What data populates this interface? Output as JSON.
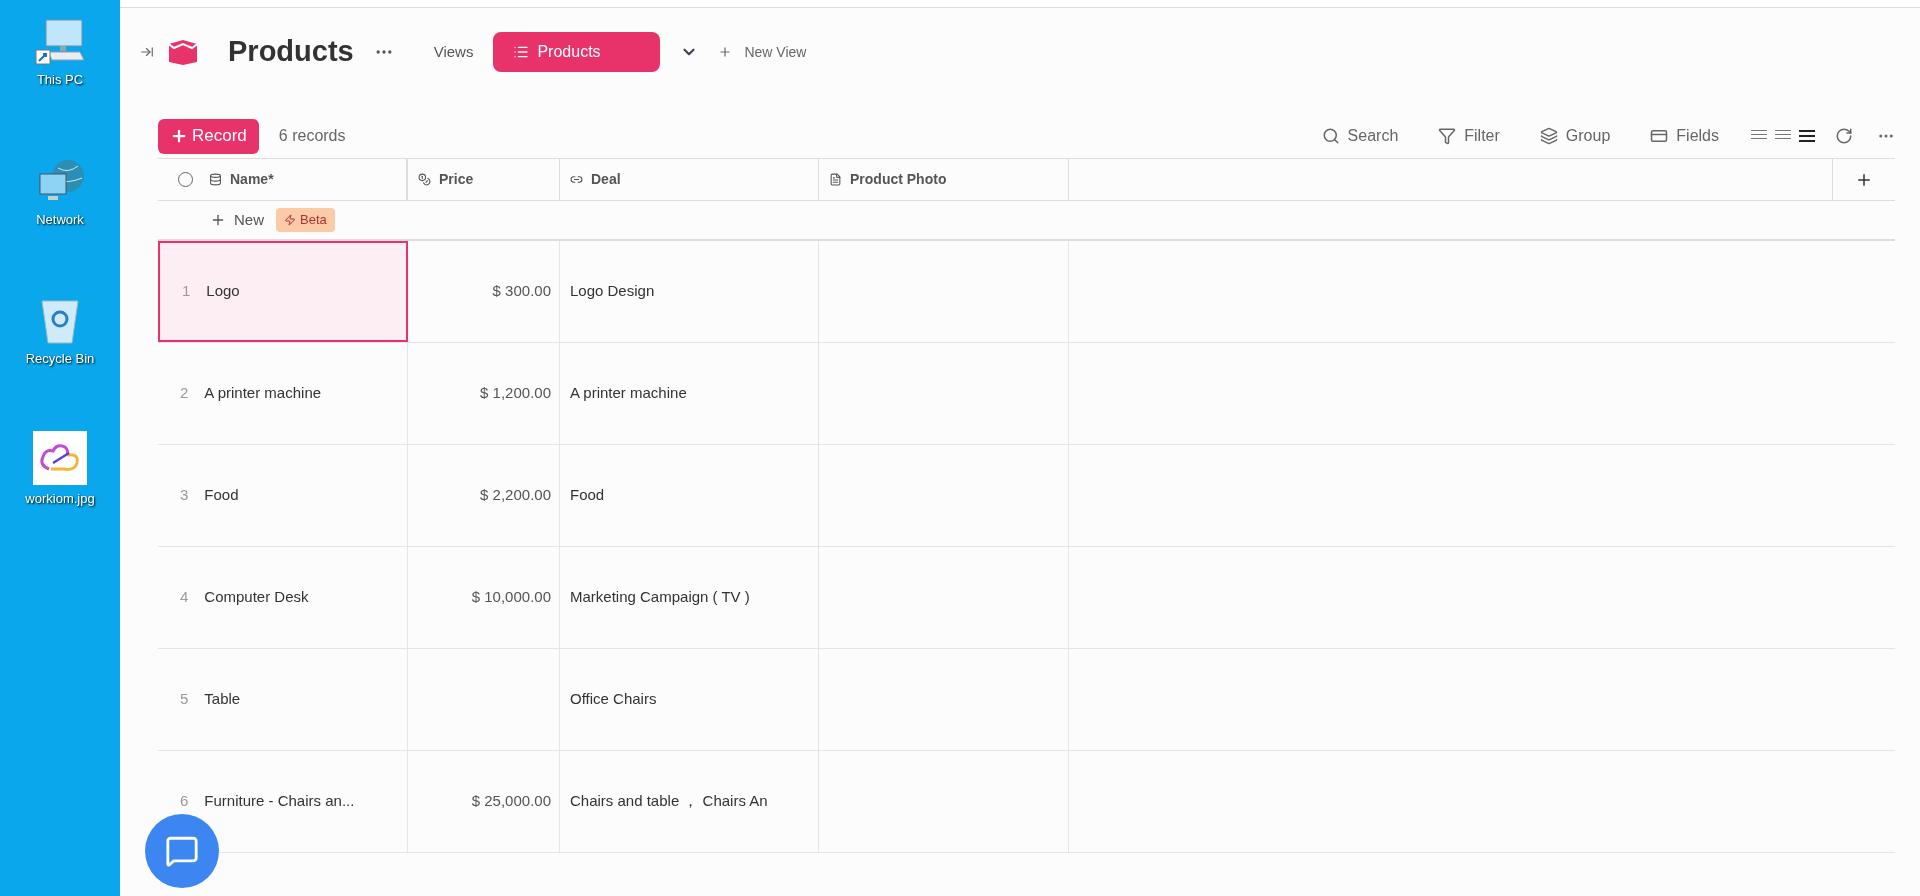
{
  "desktop_icons": [
    {
      "label": "This PC",
      "kind": "pc"
    },
    {
      "label": "Network",
      "kind": "network"
    },
    {
      "label": "Recycle Bin",
      "kind": "recycle"
    },
    {
      "label": "workiom.jpg",
      "kind": "image"
    }
  ],
  "header": {
    "title": "Products",
    "views_label": "Views",
    "views": [
      {
        "label": "Products",
        "selected": true
      }
    ],
    "new_view": "New View"
  },
  "toolbar": {
    "record_button": "Record",
    "count": "6 records",
    "tools": [
      {
        "label": "Search",
        "kind": "search"
      },
      {
        "label": "Filter",
        "kind": "filter"
      },
      {
        "label": "Group",
        "kind": "group"
      },
      {
        "label": "Fields",
        "kind": "fields"
      }
    ],
    "density": [
      {
        "selected": false
      },
      {
        "selected": false
      },
      {
        "selected": true
      }
    ]
  },
  "table": {
    "select_all": {
      "checked": false
    },
    "columns": [
      {
        "label": "Name*",
        "kind": "name"
      },
      {
        "label": "Price",
        "kind": "price"
      },
      {
        "label": "Deal",
        "kind": "link"
      },
      {
        "label": "Product Photo",
        "kind": "file"
      }
    ],
    "new_row": {
      "label": "New",
      "badge": "Beta"
    },
    "rows": [
      {
        "number": "1",
        "name": "Logo",
        "price": "$ 300.00",
        "deal": "Logo Design",
        "selected": true
      },
      {
        "number": "2",
        "name": "A printer machine",
        "price": "$ 1,200.00",
        "deal": "A printer machine",
        "selected": false
      },
      {
        "number": "3",
        "name": "Food",
        "price": "$ 2,200.00",
        "deal": "Food",
        "selected": false
      },
      {
        "number": "4",
        "name": "Computer Desk",
        "price": "$ 10,000.00",
        "deal": "Marketing Campaign ( TV )",
        "selected": false
      },
      {
        "number": "5",
        "name": "Table",
        "price": "",
        "deal": "Office Chairs",
        "selected": false
      },
      {
        "number": "6",
        "name": "Furniture - Chairs an...",
        "price": "$ 25,000.00",
        "deal": "Chairs and table ， Chairs An",
        "selected": false
      }
    ]
  }
}
